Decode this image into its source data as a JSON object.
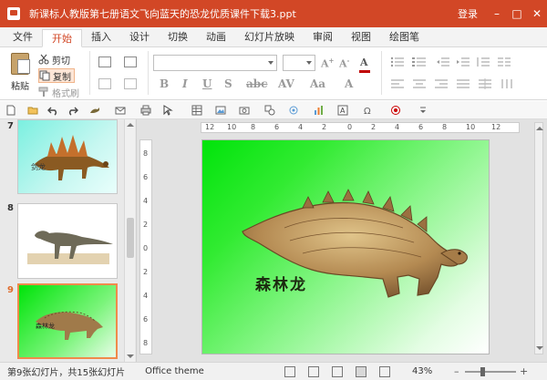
{
  "window": {
    "title": "新课标人教版第七册语文飞向蓝天的恐龙优质课件下载3.ppt",
    "login_label": "登录"
  },
  "ribbon_tabs": [
    {
      "label": "文件"
    },
    {
      "label": "开始",
      "active": true
    },
    {
      "label": "插入"
    },
    {
      "label": "设计"
    },
    {
      "label": "切换"
    },
    {
      "label": "动画"
    },
    {
      "label": "幻灯片放映"
    },
    {
      "label": "审阅"
    },
    {
      "label": "视图"
    },
    {
      "label": "绘图笔"
    }
  ],
  "clipboard": {
    "paste_label": "粘贴",
    "cut_label": "剪切",
    "copy_label": "复制",
    "format_painter_label": "格式刷"
  },
  "slides": [
    {
      "number": "7",
      "caption": "剑龙"
    },
    {
      "number": "8",
      "caption": ""
    },
    {
      "number": "9",
      "caption": "森林龙",
      "active": true
    }
  ],
  "current_slide": {
    "caption": "森林龙"
  },
  "ruler": {
    "horizontal": [
      "12",
      "10",
      "8",
      "6",
      "4",
      "2",
      "0",
      "2",
      "4",
      "6",
      "8",
      "10",
      "12"
    ],
    "vertical": [
      "8",
      "6",
      "4",
      "2",
      "0",
      "2",
      "4",
      "6",
      "8"
    ]
  },
  "status": {
    "slide_count": "第9张幻灯片，共15张幻灯片",
    "theme": "Office theme",
    "zoom": "43%"
  },
  "colors": {
    "accent": "#d24726",
    "slide_bg_start": "#00e40a",
    "slide_bg_end": "#ffffff",
    "active_thumb_border": "#f08a4b"
  },
  "icons": [
    "app-logo-icon",
    "scissors-icon",
    "copy-icon",
    "format-painter-icon",
    "new-file-icon",
    "open-folder-icon",
    "undo-icon",
    "redo-icon",
    "print-icon",
    "table-icon",
    "chart-icon",
    "symbol-icon",
    "minimize-icon",
    "maximize-icon",
    "close-icon"
  ]
}
